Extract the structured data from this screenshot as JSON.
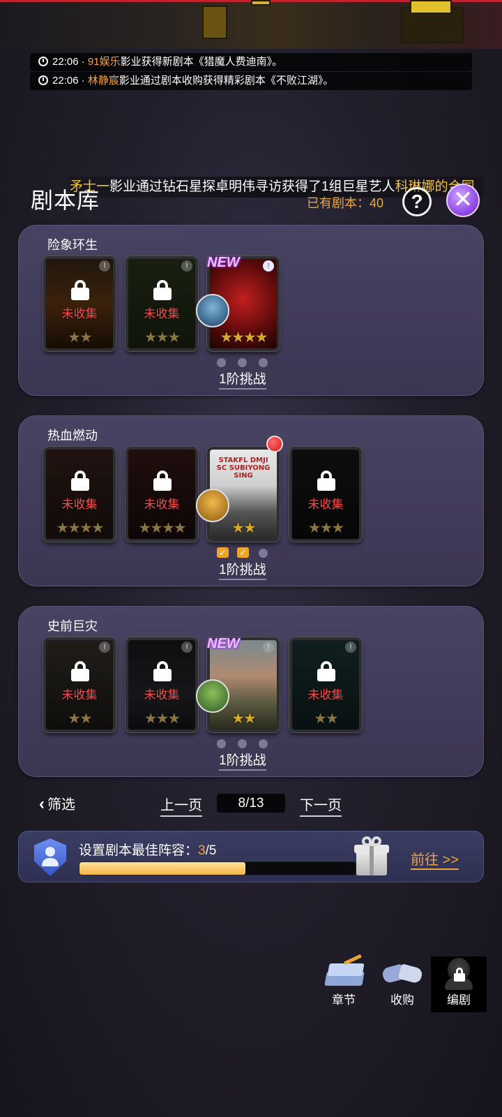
{
  "ticker": [
    {
      "time": "22:06",
      "sep": "·",
      "name": "91娱乐",
      "text": "影业获得新剧本《猎魔人费迪南》。"
    },
    {
      "time": "22:06",
      "sep": "·",
      "name": "林静宸",
      "text": "影业通过剧本收购获得精彩剧本《不败江湖》。"
    }
  ],
  "marquee": {
    "name": "矛士一",
    "text1": "影业通过钻石星探卓明伟寻访获得了1组巨星艺人",
    "highlight": "科琳娜的合同"
  },
  "header": {
    "title": "剧本库",
    "owned_label": "已有剧本：",
    "owned_count": "40",
    "help": "?",
    "close": "✕"
  },
  "panels": [
    {
      "title": "险象环生",
      "challenge": "1阶挑战",
      "cards": [
        {
          "locked": true,
          "label": "未收集",
          "stars": 2,
          "new": false
        },
        {
          "locked": true,
          "label": "未收集",
          "stars": 3,
          "new": false
        },
        {
          "locked": false,
          "label": "",
          "stars": 4,
          "new": true,
          "new_text": "NEW"
        }
      ],
      "progress": [
        "dot",
        "dot",
        "dot"
      ]
    },
    {
      "title": "热血燃动",
      "challenge": "1阶挑战",
      "cards": [
        {
          "locked": true,
          "label": "未收集",
          "stars": 4,
          "new": false
        },
        {
          "locked": true,
          "label": "未收集",
          "stars": 4,
          "new": false
        },
        {
          "locked": false,
          "label": "",
          "stars": 2,
          "new": false,
          "poster_text": "STAKFL DMJI SC SUBIYONG SING"
        },
        {
          "locked": true,
          "label": "未收集",
          "stars": 3,
          "new": false
        }
      ],
      "progress": [
        "check",
        "check",
        "dot"
      ]
    },
    {
      "title": "史前巨灾",
      "challenge": "1阶挑战",
      "cards": [
        {
          "locked": true,
          "label": "未收集",
          "stars": 2,
          "new": false
        },
        {
          "locked": true,
          "label": "未收集",
          "stars": 3,
          "new": false
        },
        {
          "locked": false,
          "label": "",
          "stars": 2,
          "new": true,
          "new_text": "NEW"
        },
        {
          "locked": true,
          "label": "未收集",
          "stars": 2,
          "new": false
        }
      ],
      "progress": [
        "dot",
        "dot",
        "dot"
      ]
    }
  ],
  "pager": {
    "filter": "筛选",
    "prev": "上一页",
    "page": "8/13",
    "next": "下一页"
  },
  "task": {
    "label": "设置剧本最佳阵容：",
    "current": "3",
    "total": "/5",
    "progress": 0.6,
    "go": "前往 >>"
  },
  "bottom_nav": [
    {
      "label": "章节",
      "icon": "book-icon"
    },
    {
      "label": "收购",
      "icon": "handshake-icon"
    },
    {
      "label": "编剧",
      "icon": "locked-writer-icon"
    }
  ]
}
